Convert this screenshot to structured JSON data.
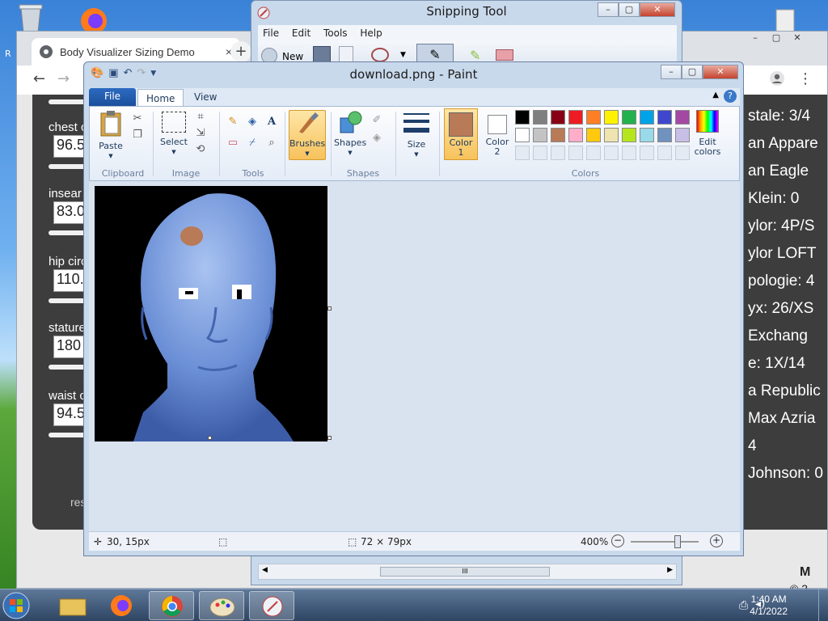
{
  "desktop": {
    "icons": [
      "recycle-bin",
      "firefox",
      "file"
    ],
    "side_label": "R"
  },
  "browser": {
    "tab_title": "Body Visualizer Sizing Demo",
    "tab_close": "×",
    "new_tab": "+",
    "left_fields": [
      {
        "label": "chest c",
        "value": "96.5"
      },
      {
        "label": "insear",
        "value": "83.0"
      },
      {
        "label": "hip circ",
        "value": "110."
      },
      {
        "label": "stature",
        "value": "180"
      },
      {
        "label": "waist c",
        "value": "94.5"
      }
    ],
    "reset_label": "res",
    "right_brands": [
      "stale: 3/4",
      "an Appare",
      "an Eagle",
      "Klein: 0",
      "ylor: 4P/S",
      "ylor LOFT",
      "pologie: 4",
      "yx: 26/XS",
      " Exchang",
      "e: 1X/14",
      "a Republic",
      "Max Azria",
      "4",
      "Johnson: 0"
    ],
    "footer_initial": "M",
    "footer_copy": "© 2"
  },
  "snipping_tool": {
    "title": "Snipping Tool",
    "menu": [
      "File",
      "Edit",
      "Tools",
      "Help"
    ],
    "new_label": "New",
    "scroll_thumb": "III"
  },
  "paint": {
    "title": "download.png - Paint",
    "tabs": {
      "file": "File",
      "home": "Home",
      "view": "View"
    },
    "groups": {
      "clipboard": "Clipboard",
      "image": "Image",
      "tools": "Tools",
      "shapes": "Shapes",
      "colors": "Colors"
    },
    "buttons": {
      "paste": "Paste",
      "select": "Select",
      "brushes": "Brushes",
      "shapes": "Shapes",
      "size": "Size",
      "color1_a": "Color",
      "color1_b": "1",
      "color2_a": "Color",
      "color2_b": "2",
      "edit_colors_a": "Edit",
      "edit_colors_b": "colors"
    },
    "palette_row1": [
      "#000000",
      "#7f7f7f",
      "#880015",
      "#ed1c24",
      "#ff7f27",
      "#fff200",
      "#22b14c",
      "#00a2e8",
      "#3f48cc",
      "#a349a4"
    ],
    "palette_row2": [
      "#ffffff",
      "#c3c3c3",
      "#b97a57",
      "#ffaec9",
      "#ffc90e",
      "#efe4b0",
      "#b5e61d",
      "#99d9ea",
      "#7092be",
      "#c8bfe7"
    ],
    "color1": "#b97a57",
    "color2": "#ffffff",
    "status": {
      "cursor": "30, 15px",
      "size": "72 × 79px",
      "zoom": "400%"
    }
  },
  "taskbar": {
    "time": "1:40 AM",
    "date": "4/1/2022"
  }
}
